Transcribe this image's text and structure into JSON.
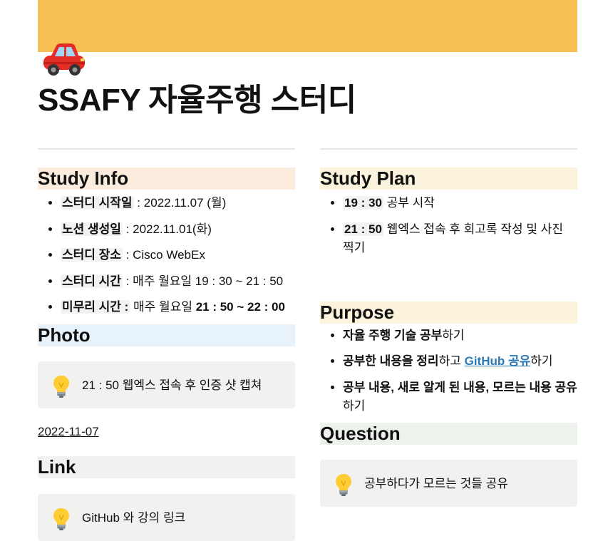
{
  "page": {
    "title": "SSAFY 자율주행 스터디",
    "icon": "car-icon"
  },
  "colors": {
    "cover": "#f8bf55",
    "study_info_bg": "#fbecdd",
    "photo_bg": "#e7f2fa",
    "link_bg": "#f1f1ef",
    "study_plan_bg": "#fbf3db",
    "purpose_bg": "#fbf3db",
    "question_bg": "#edf3ec",
    "link_text": "#2b7ab7"
  },
  "study_info": {
    "heading": "Study Info",
    "items": [
      {
        "label": "스터디 시작일",
        "sep": " : ",
        "value": "2022.11.07 (월)"
      },
      {
        "label": "노션 생성일",
        "sep": " : ",
        "value": "2022.11.01(화)"
      },
      {
        "label": "스터디 장소",
        "sep": " : ",
        "value": "Cisco WebEx"
      },
      {
        "label": "스터디 시간",
        "sep": " : ",
        "value": "매주 월요일 19 : 30 ~ 21 : 50"
      },
      {
        "label": "미무리 시간 :",
        "sep": " ",
        "value": "매주 월요일 ",
        "value_bold": "21 : 50 ~ 22 : 00"
      }
    ]
  },
  "photo": {
    "heading": "Photo",
    "callout": "21 : 50 웹엑스 접속 후 인증 샷 캡쳐",
    "date": "2022-11-07"
  },
  "link": {
    "heading": "Link",
    "callout": "GitHub 와 강의 링크"
  },
  "study_plan": {
    "heading": "Study Plan",
    "items": [
      {
        "time": "19 : 30",
        "text": " 공부 시작"
      },
      {
        "time": "21 : 50",
        "text": " 웹엑스 접속 후 회고록 작성 및 사진 찍기"
      }
    ]
  },
  "purpose": {
    "heading": "Purpose",
    "item1_bold": "자율 주행 기술 공부",
    "item1_rest": "하기",
    "item2_bold": "공부한 내용을 정리",
    "item2_mid": "하고 ",
    "item2_link": "GitHub 공유",
    "item2_rest": "하기",
    "item3_bold": "공부 내용, 새로 알게 된 내용, 모르는 내용  공유",
    "item3_rest": "하기"
  },
  "question": {
    "heading": "Question",
    "callout": "공부하다가 모르는 것들 공유"
  }
}
